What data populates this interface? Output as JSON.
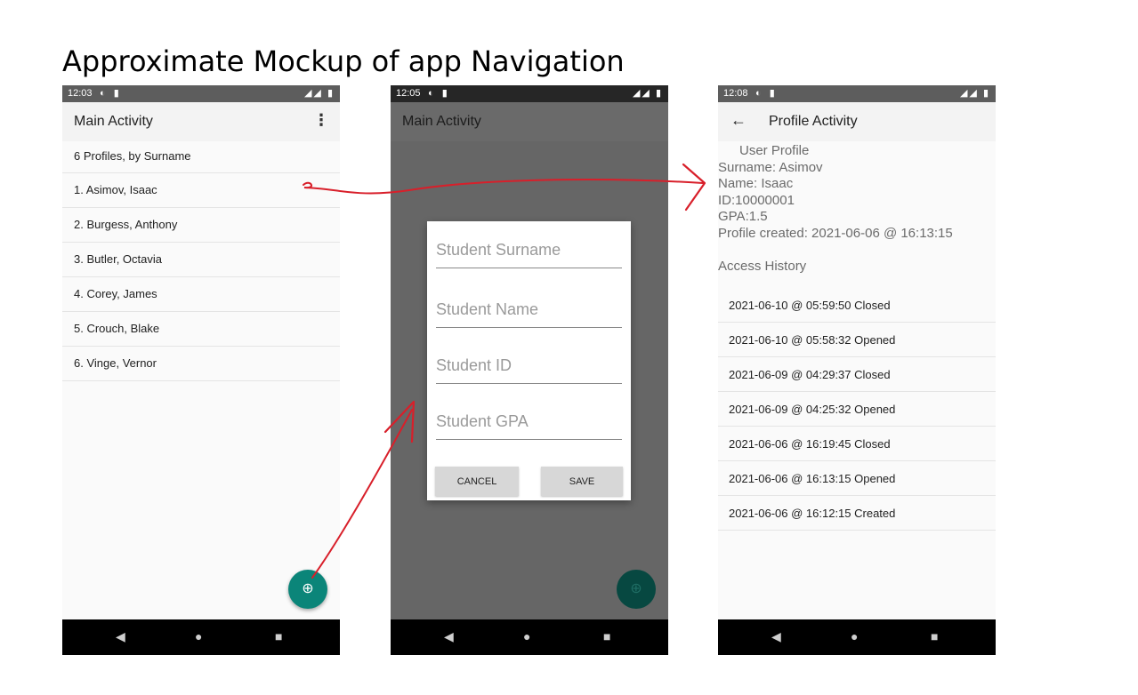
{
  "slide_title": "Approximate Mockup of app Navigation",
  "colors": {
    "fab": "#0b8579",
    "annotation_arrow": "#d81f2a",
    "status_bar": "#5d5d5d"
  },
  "screens": {
    "main": {
      "time": "12:03",
      "title": "Main Activity",
      "list_header": "6 Profiles, by Surname",
      "profiles": [
        "1. Asimov, Isaac",
        "2. Burgess, Anthony",
        "3. Butler, Octavia",
        "4. Corey, James",
        "5. Crouch, Blake",
        "6. Vinge, Vernor"
      ]
    },
    "dialog_screen": {
      "time": "12:05",
      "title": "Main Activity",
      "fields": {
        "surname_placeholder": "Student Surname",
        "name_placeholder": "Student Name",
        "id_placeholder": "Student ID",
        "gpa_placeholder": "Student GPA"
      },
      "cancel_label": "CANCEL",
      "save_label": "SAVE"
    },
    "profile": {
      "time": "12:08",
      "title": "Profile Activity",
      "info": [
        "User Profile",
        "Surname: Asimov",
        "Name: Isaac",
        "ID:10000001",
        "GPA:1.5",
        "Profile created: 2021-06-06 @ 16:13:15"
      ],
      "history_title": "Access History",
      "history": [
        "2021-06-10 @ 05:59:50 Closed",
        "2021-06-10 @ 05:58:32 Opened",
        "2021-06-09 @ 04:29:37 Closed",
        "2021-06-09 @ 04:25:32 Opened",
        "2021-06-06 @ 16:19:45 Closed",
        "2021-06-06 @ 16:13:15 Opened",
        "2021-06-06 @ 16:12:15 Created"
      ]
    }
  },
  "icons": {
    "fab": "add-circle-icon",
    "overflow": "more-vert-icon",
    "back": "arrow-back-icon",
    "nav": [
      "back-triangle-icon",
      "home-circle-icon",
      "recents-square-icon"
    ]
  }
}
